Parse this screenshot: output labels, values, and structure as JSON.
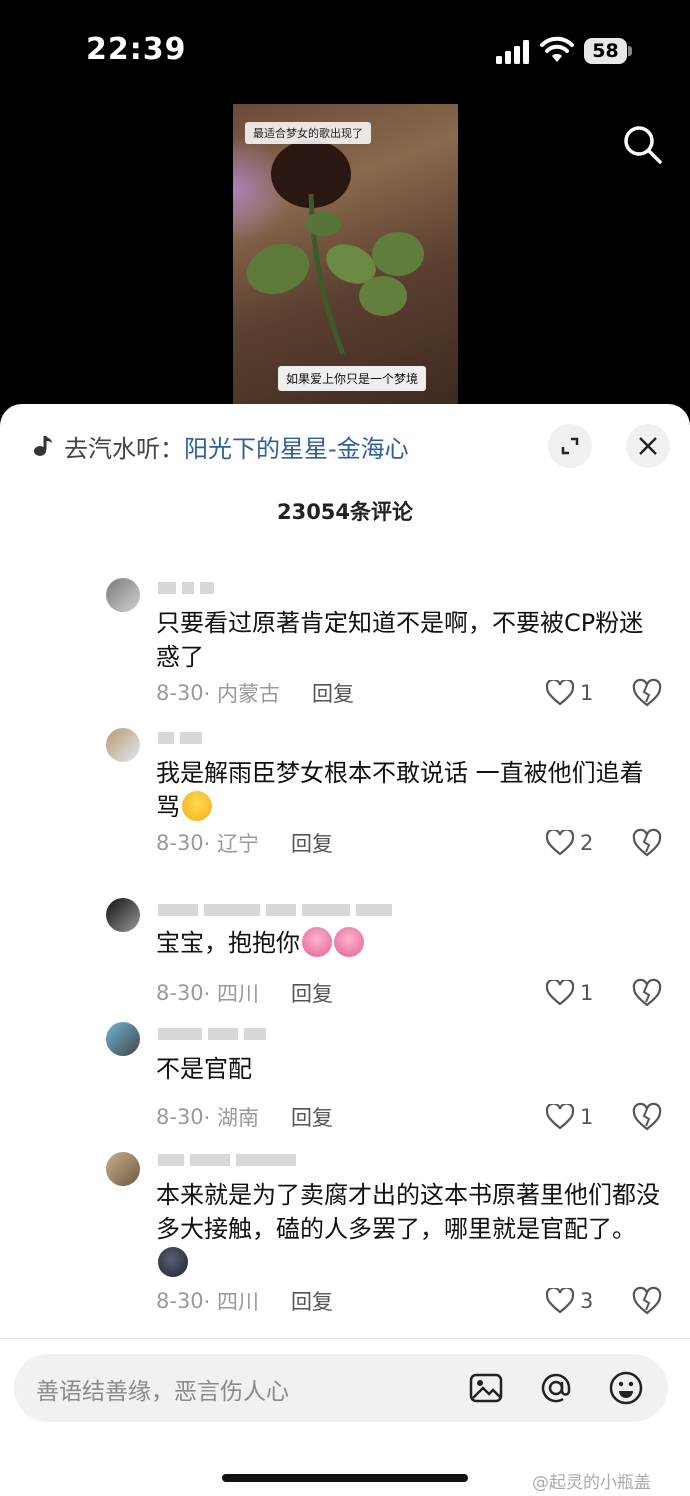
{
  "status_bar": {
    "time": "22:39",
    "battery": "58"
  },
  "video": {
    "caption_top": "最适合梦女的歌出现了",
    "caption_bottom": "如果爱上你只是一个梦境"
  },
  "music": {
    "prefix": "去汽水听：",
    "song": "阳光下的星星-金海心"
  },
  "comment_count": "23054条评论",
  "comments": [
    {
      "text": "只要看过原著肯定知道不是啊，不要被CP粉迷惑了",
      "date": "8-30",
      "location": "· 内蒙古",
      "reply": "回复",
      "likes": "1"
    },
    {
      "text": "我是解雨臣梦女根本不敢说话 一直被他们追着骂",
      "date": "8-30",
      "location": "· 辽宁",
      "reply": "回复",
      "likes": "2"
    },
    {
      "text": "宝宝，抱抱你",
      "date": "8-30",
      "location": "· 四川",
      "reply": "回复",
      "likes": "1"
    },
    {
      "text": "不是官配",
      "date": "8-30",
      "location": "· 湖南",
      "reply": "回复",
      "likes": "1"
    },
    {
      "text": "本来就是为了卖腐才出的这本书原著里他们都没多大接触，磕的人多罢了，哪里就是官配了。",
      "date": "8-30",
      "location": "· 四川",
      "reply": "回复",
      "likes": "3"
    }
  ],
  "input": {
    "placeholder": "善语结善缘，恶言伤人心"
  },
  "watermark": "@起灵的小瓶盖",
  "icons": {
    "search": "search-icon",
    "music": "music-note-icon",
    "expand": "expand-icon",
    "close": "close-icon",
    "like": "heart-icon",
    "dislike": "broken-heart-icon",
    "image": "image-icon",
    "mention": "at-icon",
    "emoji": "emoji-icon"
  }
}
